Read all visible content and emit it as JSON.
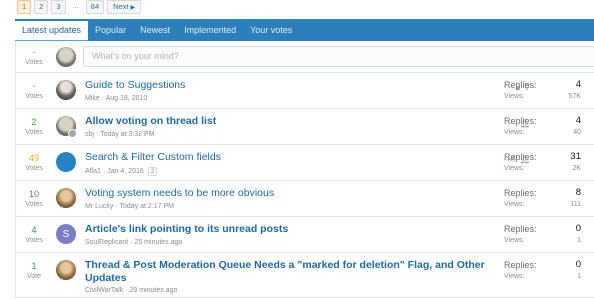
{
  "pagination": {
    "pages": [
      "1",
      "2",
      "3",
      "...",
      "84"
    ],
    "current": "1",
    "next_label": "Next",
    "next_icon": "chevron-right-icon"
  },
  "tabs": [
    "Latest updates",
    "Popular",
    "Newest",
    "Implemented",
    "Your votes"
  ],
  "composer": {
    "votes_count": "-",
    "votes_label": "Votes",
    "placeholder": "What's on your mind?"
  },
  "threads": [
    {
      "votes": "-",
      "votes_label": "Votes",
      "title": "Guide to Suggestions",
      "author": "Mike",
      "date": "Aug 18, 2010",
      "status_icons": [
        "lock-icon",
        "pin-icon"
      ],
      "replies_label": "Replies:",
      "replies": "4",
      "views_label": "Views:",
      "views": "57K"
    },
    {
      "votes": "2",
      "votes_label": "Votes",
      "title": "Allow voting on thread list",
      "author": "sbj",
      "date": "Today at 3:32 PM",
      "status_icons": [
        "bell-icon"
      ],
      "replies_label": "Replies:",
      "replies": "4",
      "views_label": "Views:",
      "views": "40"
    },
    {
      "votes": "49",
      "votes_label": "Votes",
      "title": "Search & Filter Custom fields",
      "author": "Alfa1",
      "date": "Jan 4, 2016",
      "page_badge": "2",
      "status_icons": [
        "thumbs-up-icon",
        "bell-icon"
      ],
      "replies_label": "Replies:",
      "replies": "31",
      "views_label": "Views:",
      "views": "2K"
    },
    {
      "votes": "10",
      "votes_label": "Votes",
      "title": "Voting system needs to be more obvious",
      "author": "Mr Lucky",
      "date": "Today at 2:17 PM",
      "replies_label": "Replies:",
      "replies": "8",
      "views_label": "Views:",
      "views": "111"
    },
    {
      "votes": "4",
      "votes_label": "Votes",
      "title": "Article's link pointing to its unread posts",
      "author": "SoulReplicant",
      "date": "25 minutes ago",
      "avatar_letter": "S",
      "replies_label": "Replies:",
      "replies": "0",
      "views_label": "Views:",
      "views": "1"
    },
    {
      "votes": "1",
      "votes_label": "Vote",
      "title": "Thread & Post Moderation Queue Needs a \"marked for deletion\" Flag, and Other Updates",
      "author": "CivilWarTalk",
      "date": "29 minutes ago",
      "replies_label": "Replies:",
      "replies": "0",
      "views_label": "Views:",
      "views": "1"
    }
  ],
  "colors": {
    "accent": "#2b7fbb",
    "link": "#1d6aa3",
    "vote_green": "#3fa03f",
    "vote_gold": "#e5a93a"
  }
}
